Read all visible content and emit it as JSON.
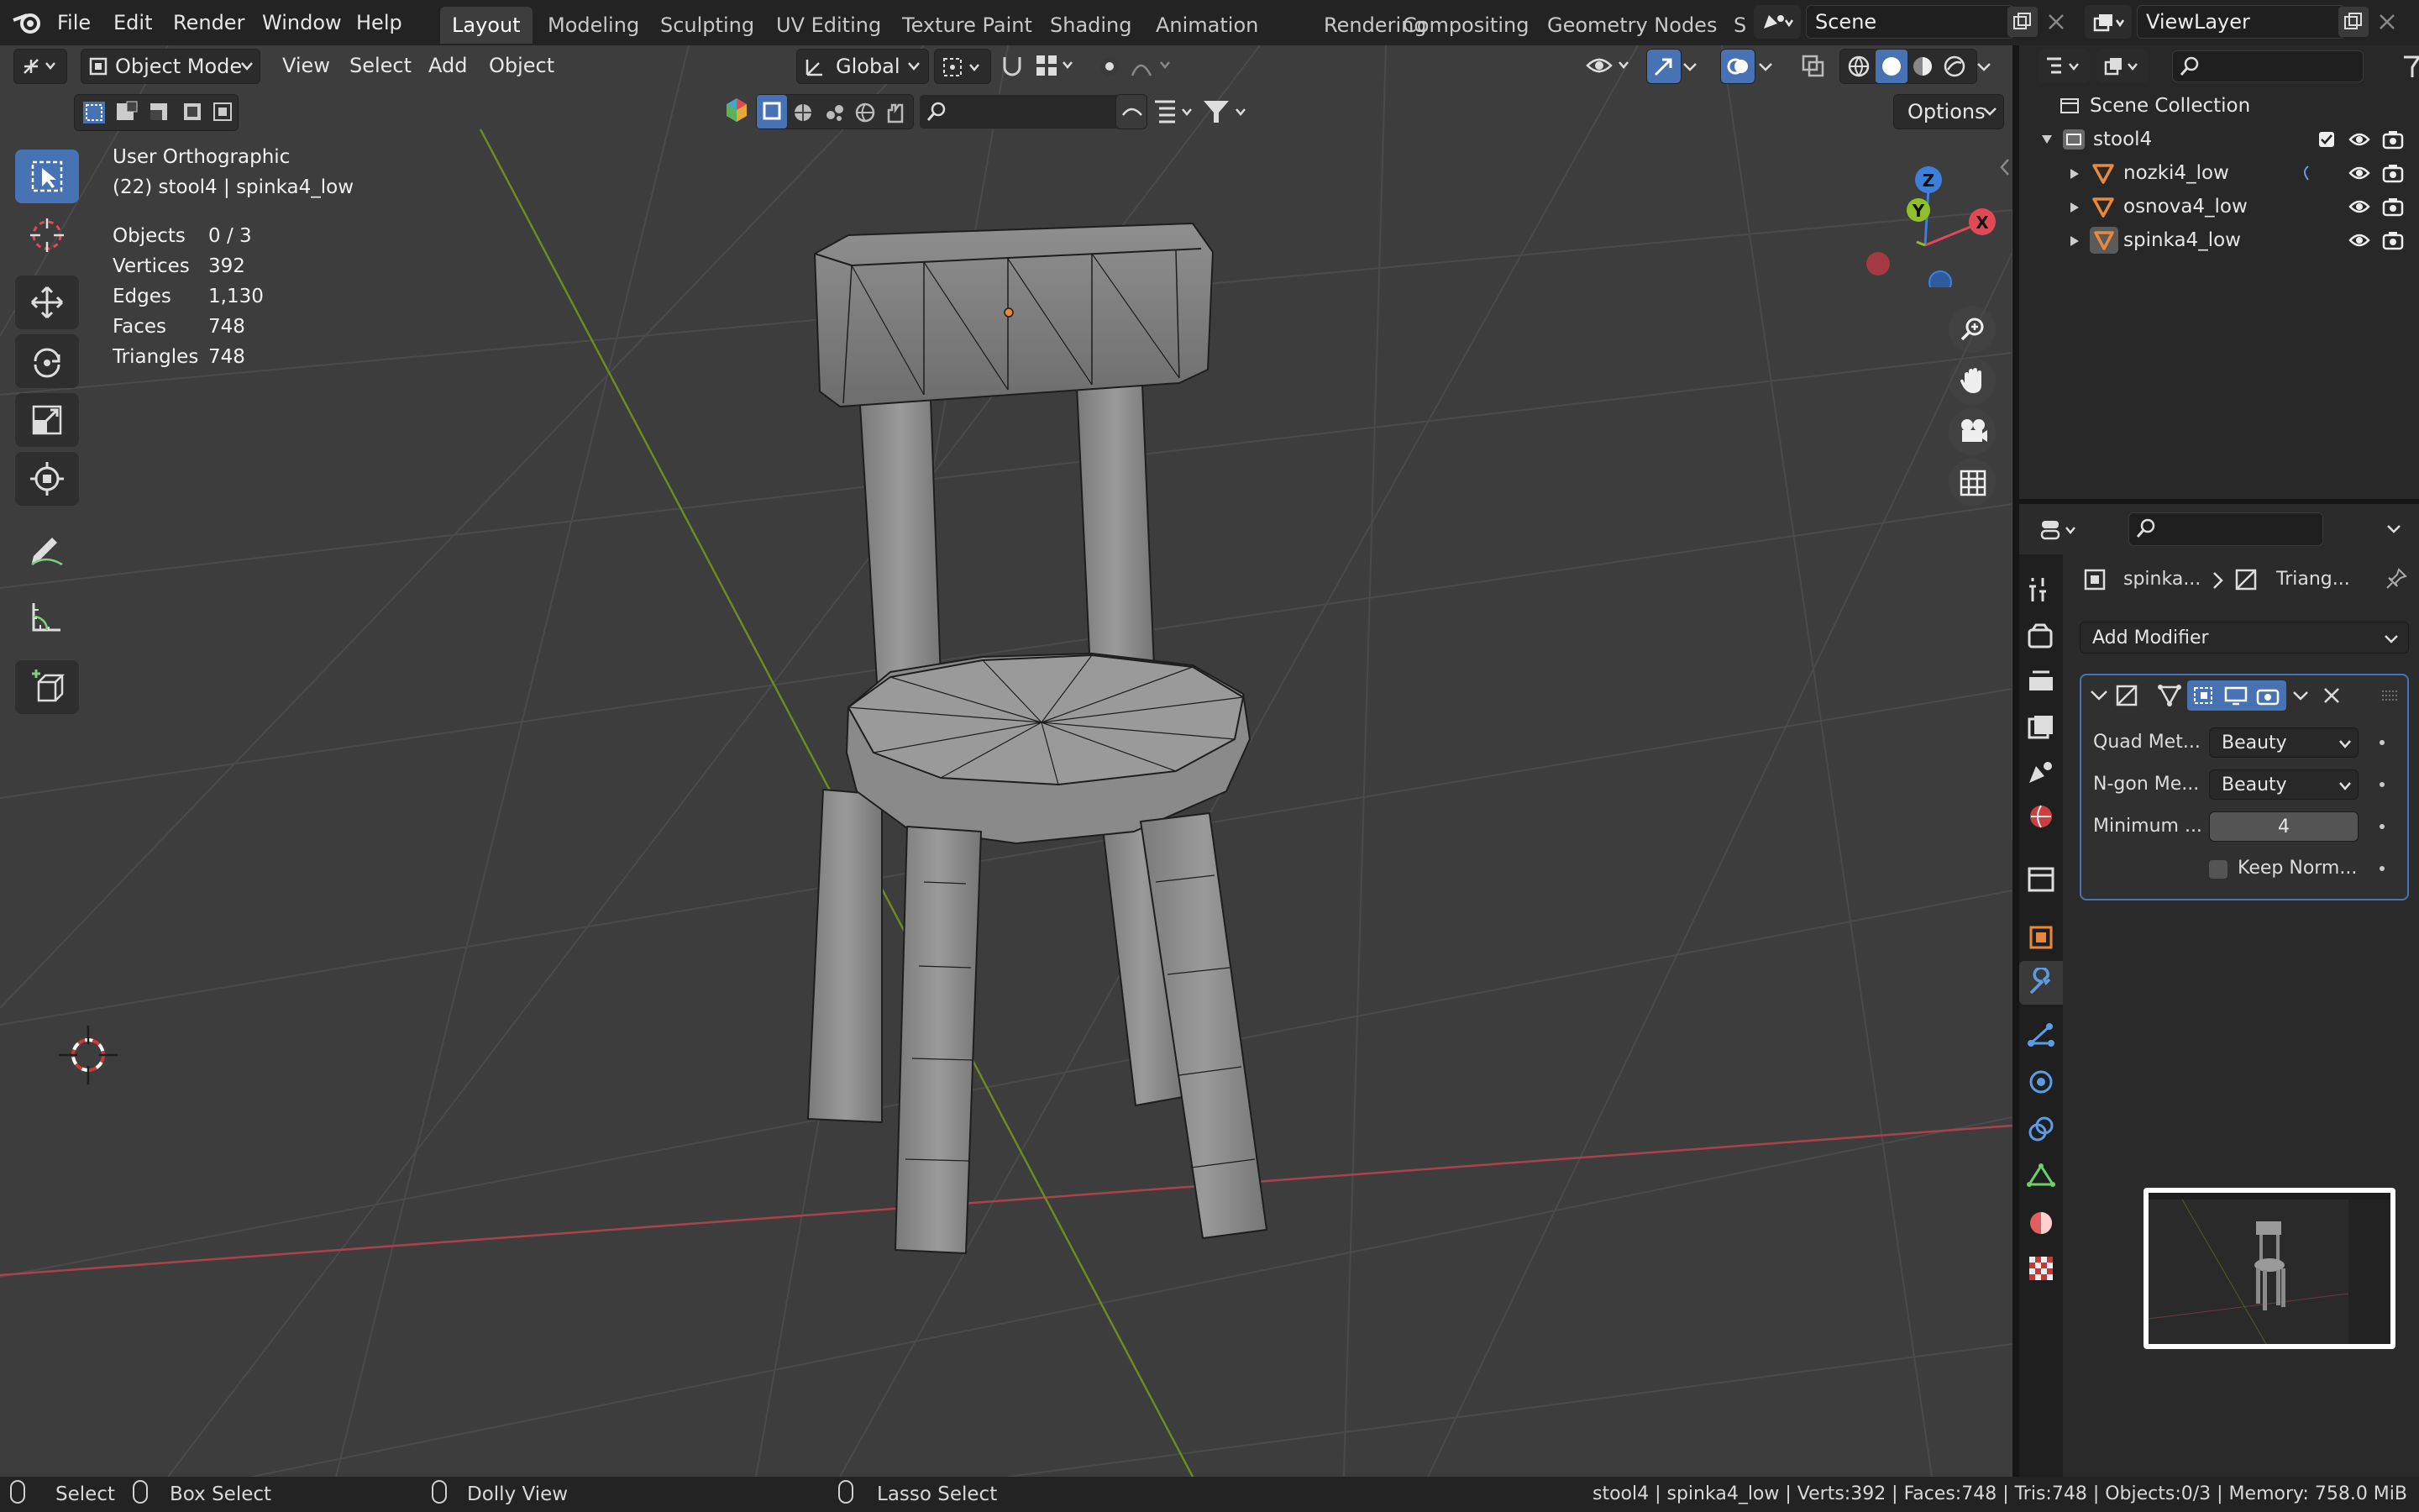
{
  "topbar": {
    "menus": [
      "File",
      "Edit",
      "Render",
      "Window",
      "Help"
    ],
    "workspaces": [
      "Layout",
      "Modeling",
      "Sculpting",
      "UV Editing",
      "Texture Paint",
      "Shading",
      "Animation",
      "Rendering",
      "Compositing",
      "Geometry Nodes",
      "S"
    ],
    "active_workspace": "Layout",
    "scene_name": "Scene",
    "view_layer": "ViewLayer"
  },
  "viewport_header": {
    "mode": "Object Mode",
    "menus": [
      "View",
      "Select",
      "Add",
      "Object"
    ],
    "orientation": "Global",
    "options_label": "Options"
  },
  "overlay": {
    "view_name": "User Orthographic",
    "context": "(22) stool4 | spinka4_low",
    "stats": [
      {
        "label": "Objects",
        "value": "0 / 3"
      },
      {
        "label": "Vertices",
        "value": "392"
      },
      {
        "label": "Edges",
        "value": "1,130"
      },
      {
        "label": "Faces",
        "value": "748"
      },
      {
        "label": "Triangles",
        "value": "748"
      }
    ]
  },
  "gizmo": {
    "z": "Z",
    "y": "Y",
    "x": "X"
  },
  "outliner": {
    "title": "Scene Collection",
    "collection": "stool4",
    "objects": [
      "nozki4_low",
      "osnova4_low",
      "spinka4_low"
    ]
  },
  "properties": {
    "breadcrumb_object": "spinka...",
    "breadcrumb_modifier": "Triang...",
    "add_modifier": "Add Modifier",
    "fields": [
      {
        "label": "Quad Met...",
        "value": "Beauty"
      },
      {
        "label": "N-gon Me...",
        "value": "Beauty"
      },
      {
        "label": "Minimum ...",
        "value": "4"
      }
    ],
    "keep_normals": "Keep Norm..."
  },
  "statusbar": {
    "select": "Select",
    "box_select": "Box Select",
    "dolly_view": "Dolly View",
    "lasso_select": "Lasso Select",
    "info": "stool4 | spinka4_low | Verts:392 | Faces:748 | Tris:748 | Objects:0/3 | Memory: 758.0 MiB"
  },
  "colors": {
    "accent": "#4772b3",
    "viewport_bg": "#3d3d3d",
    "axis_x": "#e04a57",
    "axis_y": "#8fbf2a",
    "axis_z": "#3d7fd9",
    "object_orange": "#e8883a"
  }
}
